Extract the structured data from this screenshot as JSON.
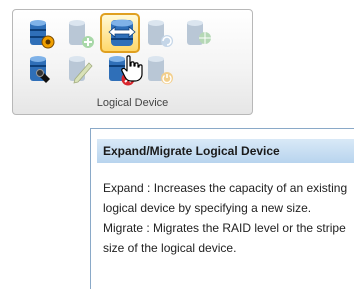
{
  "ribbon_group": {
    "label": "Logical Device",
    "buttons": [
      {
        "name": "logical-device-properties",
        "icon": "database-gear-icon",
        "enabled": true
      },
      {
        "name": "create-logical-device",
        "icon": "database-plus-icon",
        "enabled": false
      },
      {
        "name": "expand-migrate-logical-device",
        "icon": "database-expand-icon",
        "enabled": true,
        "hovered": true
      },
      {
        "name": "copy-logical-device",
        "icon": "database-copy-icon",
        "enabled": false
      },
      {
        "name": "logical-device-network",
        "icon": "database-globe-icon",
        "enabled": false
      },
      {
        "name": "locate-logical-device",
        "icon": "database-flashlight-icon",
        "enabled": true
      },
      {
        "name": "edit-logical-device",
        "icon": "database-pencil-icon",
        "enabled": false
      },
      {
        "name": "delete-logical-device",
        "icon": "database-delete-icon",
        "enabled": true
      },
      {
        "name": "power-logical-device",
        "icon": "database-power-icon",
        "enabled": false
      }
    ]
  },
  "tooltip": {
    "title": "Expand/Migrate Logical Device",
    "expand_text": "Expand : Increases the capacity of an existing logical device by specifying a new size.",
    "migrate_text": "Migrate : Migrates the RAID level or the stripe size of the logical device."
  },
  "colors": {
    "db_blue": "#2f6fb8",
    "db_dark": "#0d3f7a",
    "disabled": "#b9c7d6",
    "tooltip_title_bg": "#c6dcf1",
    "hover_border": "#e0a020"
  }
}
